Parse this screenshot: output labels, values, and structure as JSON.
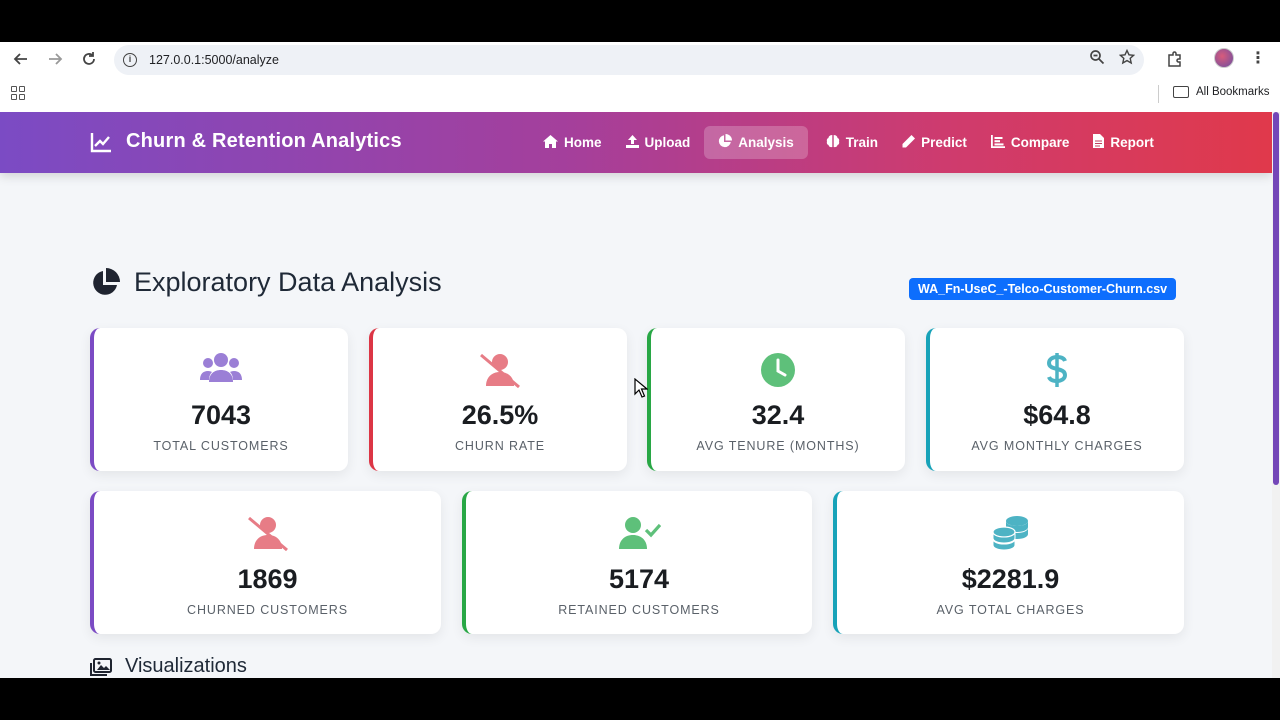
{
  "browser": {
    "url": "127.0.0.1:5000/analyze",
    "bookmarks_label": "All Bookmarks"
  },
  "app": {
    "title": "Churn & Retention Analytics",
    "nav": [
      {
        "label": "Home",
        "icon": "home-icon",
        "active": false
      },
      {
        "label": "Upload",
        "icon": "upload-icon",
        "active": false
      },
      {
        "label": "Analysis",
        "icon": "pie-chart-icon",
        "active": true
      },
      {
        "label": "Train",
        "icon": "brain-icon",
        "active": false
      },
      {
        "label": "Predict",
        "icon": "pencil-icon",
        "active": false
      },
      {
        "label": "Compare",
        "icon": "bar-chart-icon",
        "active": false
      },
      {
        "label": "Report",
        "icon": "file-icon",
        "active": false
      }
    ],
    "accent_gradient": [
      "#7b4bc4",
      "#e0394b"
    ]
  },
  "section": {
    "title": "Exploratory Data Analysis",
    "file_badge": "WA_Fn-UseC_-Telco-Customer-Churn.csv"
  },
  "stats_row1": [
    {
      "value": "7043",
      "label": "Total Customers",
      "icon": "users-icon",
      "color": "#7b4bc4"
    },
    {
      "value": "26.5%",
      "label": "Churn Rate",
      "icon": "user-slash-icon",
      "color": "#dc3545"
    },
    {
      "value": "32.4",
      "label": "Avg Tenure (Months)",
      "icon": "clock-icon",
      "color": "#28a745"
    },
    {
      "value": "$64.8",
      "label": "Avg Monthly Charges",
      "icon": "dollar-icon",
      "color": "#17a2b8"
    }
  ],
  "stats_row2": [
    {
      "value": "1869",
      "label": "Churned Customers",
      "icon": "user-slash-icon",
      "color": "#7b4bc4"
    },
    {
      "value": "5174",
      "label": "Retained Customers",
      "icon": "user-check-icon",
      "color": "#28a745"
    },
    {
      "value": "$2281.9",
      "label": "Avg Total Charges",
      "icon": "coins-icon",
      "color": "#17a2b8"
    }
  ],
  "visualizations": {
    "title": "Visualizations"
  }
}
